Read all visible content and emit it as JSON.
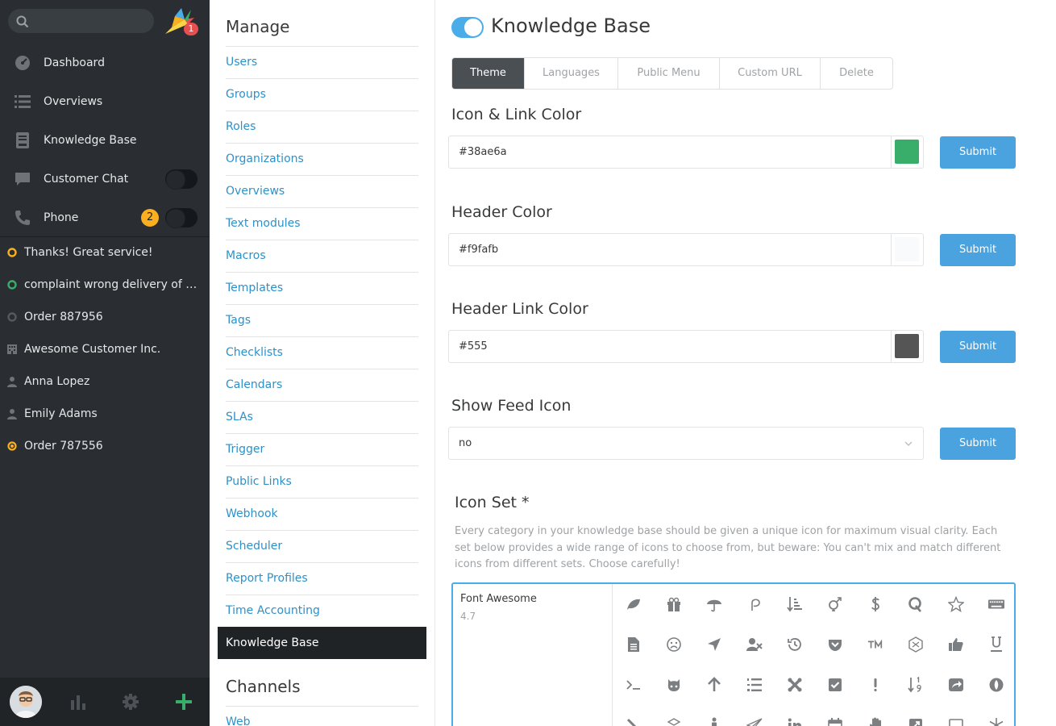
{
  "nav": {
    "search_placeholder": "",
    "notification_count": "1",
    "items": [
      {
        "label": "Dashboard",
        "icon": "dashboard-icon"
      },
      {
        "label": "Overviews",
        "icon": "overviews-icon"
      },
      {
        "label": "Knowledge Base",
        "icon": "knowledge-base-icon"
      },
      {
        "label": "Customer Chat",
        "icon": "chat-icon"
      },
      {
        "label": "Phone",
        "icon": "phone-icon",
        "badge": "2"
      }
    ],
    "tasks": [
      {
        "label": "Thanks! Great service!",
        "icon": "ticket-open-icon",
        "color": "#faaf21"
      },
      {
        "label": "complaint wrong delivery of order",
        "icon": "ticket-open-icon",
        "color": "#38ae6a"
      },
      {
        "label": "Order 887956",
        "icon": "ticket-closed-icon",
        "color": "#6f7377"
      },
      {
        "label": "Awesome Customer Inc.",
        "icon": "organization-icon",
        "color": "#6f7377"
      },
      {
        "label": "Anna Lopez",
        "icon": "user-icon",
        "color": "#6f7377"
      },
      {
        "label": "Emily Adams",
        "icon": "user-icon",
        "color": "#6f7377"
      },
      {
        "label": "Order 787556",
        "icon": "ticket-pending-icon",
        "color": "#faaf21"
      }
    ]
  },
  "menu": {
    "manage_heading": "Manage",
    "items": [
      "Users",
      "Groups",
      "Roles",
      "Organizations",
      "Overviews",
      "Text modules",
      "Macros",
      "Templates",
      "Tags",
      "Checklists",
      "Calendars",
      "SLAs",
      "Trigger",
      "Public Links",
      "Webhook",
      "Scheduler",
      "Report Profiles",
      "Time Accounting",
      "Knowledge Base"
    ],
    "active_item": "Knowledge Base",
    "channels_heading": "Channels",
    "channels_items": [
      "Web"
    ]
  },
  "main": {
    "title": "Knowledge Base",
    "enabled": true,
    "tabs": [
      {
        "label": "Theme",
        "active": true
      },
      {
        "label": "Languages",
        "active": false
      },
      {
        "label": "Public Menu",
        "active": false
      },
      {
        "label": "Custom URL",
        "active": false
      },
      {
        "label": "Delete",
        "active": false
      }
    ],
    "icon_link_color": {
      "label": "Icon & Link Color",
      "value": "#38ae6a",
      "swatch": "#38ae6a"
    },
    "header_color": {
      "label": "Header Color",
      "value": "#f9fafb",
      "swatch": "#f9fafb"
    },
    "header_link_color": {
      "label": "Header Link Color",
      "value": "#555",
      "swatch": "#555555"
    },
    "show_feed_icon": {
      "label": "Show Feed Icon",
      "value": "no"
    },
    "submit_label": "Submit",
    "icon_set": {
      "label": "Icon Set *",
      "description": "Every category in your knowledge base should be given a unique icon for maximum visual clarity. Each set below provides a wide range of icons to choose from, but beware: You can't mix and match different icons from different sets. Choose carefully!",
      "name": "Font Awesome",
      "version": "4.7"
    }
  }
}
